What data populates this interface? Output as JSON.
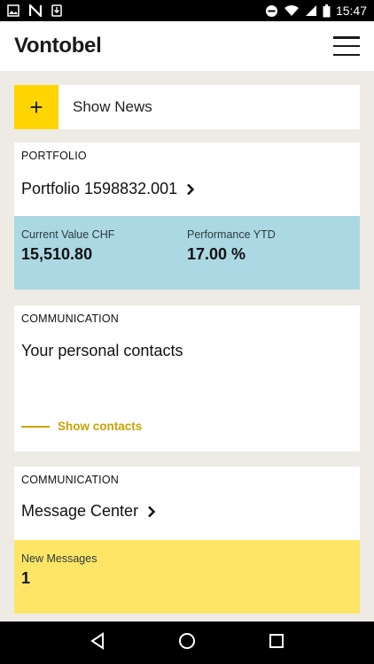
{
  "status_bar": {
    "time": "15:47",
    "icons_left": [
      "gallery-icon",
      "n-app-icon",
      "download-icon"
    ],
    "icons_right": [
      "do-not-disturb-icon",
      "wifi-icon",
      "signal-icon",
      "battery-icon"
    ]
  },
  "app_bar": {
    "logo": "Vontobel",
    "menu_icon": "hamburger-menu-icon"
  },
  "news": {
    "icon": "+",
    "label": "Show News"
  },
  "portfolio": {
    "kicker": "PORTFOLIO",
    "title": "Portfolio 1598832.001",
    "stats": [
      {
        "label": "Current Value CHF",
        "value": "15,510.80"
      },
      {
        "label": "Performance YTD",
        "value": "17.00 %"
      }
    ]
  },
  "contacts": {
    "kicker": "COMMUNICATION",
    "title": "Your personal contacts",
    "link": "Show contacts"
  },
  "messages": {
    "kicker": "COMMUNICATION",
    "title": "Message Center",
    "stat_label": "New Messages",
    "stat_value": "1"
  },
  "colors": {
    "accent_yellow": "#ffd500",
    "portfolio_blue": "#abd8e3",
    "messages_yellow": "#ffe566",
    "link_gold": "#c9a300",
    "background": "#eeebe4"
  },
  "nav_bar": {
    "icons": [
      "back-icon",
      "home-icon",
      "recents-icon"
    ]
  }
}
